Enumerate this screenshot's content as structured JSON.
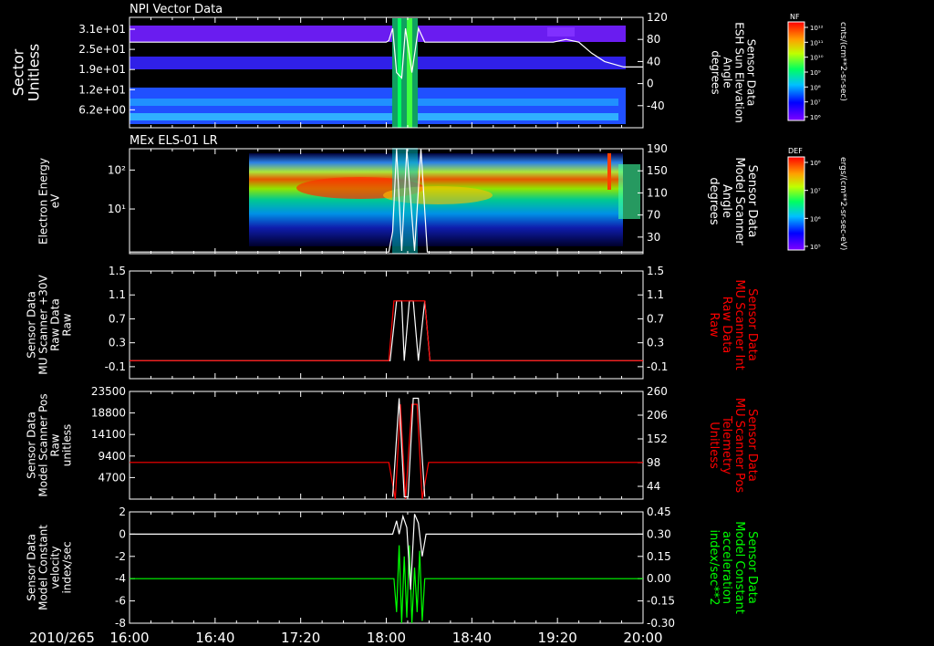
{
  "figure": {
    "date_label": "2010/265",
    "time_ticks": [
      "16:00",
      "16:40",
      "17:20",
      "18:00",
      "18:40",
      "19:20",
      "20:00"
    ],
    "time_range_hours": [
      16.0,
      20.0
    ],
    "background": "#000000",
    "axis_color": "#ffffff"
  },
  "chart_data": [
    {
      "id": "npi",
      "type": "heatmap",
      "title": "NPI Vector Data",
      "ylabel_lines": [
        "Sector",
        "Unitless"
      ],
      "y_ticks": [
        "3.1e+01",
        "2.5e+01",
        "1.9e+01",
        "1.2e+01",
        "6.2e+00"
      ],
      "right_ticks": [
        "120",
        "80",
        "40",
        "0",
        "-40"
      ],
      "right_range": [
        -80,
        120
      ],
      "right_label_lines": [
        "Sensor Data",
        "ESH Sun Elevation",
        "Angle",
        "degrees"
      ],
      "colorbar": {
        "title": "NF",
        "tick_labels": [
          "10¹²",
          "10¹¹",
          "10¹⁰",
          "10⁹",
          "10⁸",
          "10⁷",
          "10⁶"
        ],
        "unit": "cnts/(cm**2-sr-sec)"
      },
      "series": [
        {
          "color": "#ffffff",
          "x": [
            16.0,
            16.5,
            17.0,
            17.5,
            18.0,
            18.02,
            18.05,
            18.08,
            18.12,
            18.15,
            18.2,
            18.25,
            18.3,
            18.6,
            19.0,
            19.3,
            19.4,
            19.5,
            19.6,
            19.7,
            19.85,
            20.0
          ],
          "y": [
            75,
            75,
            75,
            75,
            75,
            78,
            100,
            20,
            10,
            100,
            20,
            100,
            75,
            75,
            75,
            75,
            80,
            75,
            55,
            40,
            30,
            30
          ]
        }
      ]
    },
    {
      "id": "els",
      "type": "heatmap",
      "title": "MEx ELS-01 LR",
      "ylabel_lines": [
        "Electron Energy",
        "eV"
      ],
      "y_ticks": [
        "10²",
        "10¹"
      ],
      "right_ticks": [
        "190",
        "150",
        "110",
        "70",
        "30"
      ],
      "right_range": [
        0,
        190
      ],
      "right_label_lines": [
        "Sensor Data",
        "Model Scanner",
        "Angle",
        "degrees"
      ],
      "colorbar": {
        "title": "DEF",
        "tick_labels": [
          "10⁸",
          "10⁷",
          "10⁶",
          "10⁵"
        ],
        "unit": "ergs/(cm**2-sr-sec-eV)"
      },
      "series": [
        {
          "color": "#ffffff",
          "x": [
            16.0,
            18.02,
            18.05,
            18.08,
            18.12,
            18.16,
            18.22,
            18.27,
            18.32,
            20.0
          ],
          "y": [
            3,
            3,
            40,
            190,
            5,
            190,
            5,
            190,
            3,
            3
          ]
        }
      ]
    },
    {
      "id": "raw",
      "type": "line",
      "title": "",
      "ylabel_lines": [
        "Sensor Data",
        "MU Scanner +30V",
        "Raw Data",
        "Raw"
      ],
      "ylabel_color": "#ffffff",
      "y_ticks": [
        "1.5",
        "1.1",
        "0.7",
        "0.3",
        "-0.1"
      ],
      "y_range": [
        -0.3,
        1.5
      ],
      "right_ticks": [
        "1.5",
        "1.1",
        "0.7",
        "0.3",
        "-0.1"
      ],
      "right_label_lines": [
        "Sensor Data",
        "MU Scanner Int",
        "Raw Data",
        "Raw"
      ],
      "right_label_color": "#ff0000",
      "series": [
        {
          "color": "#ffffff",
          "x": [
            16.0,
            18.03,
            18.08,
            18.12,
            18.14,
            18.18,
            18.21,
            18.25,
            18.3,
            18.34,
            20.0
          ],
          "y": [
            0,
            0,
            1.0,
            1.0,
            0,
            1.0,
            1.0,
            0,
            1.0,
            0,
            0
          ]
        },
        {
          "color": "#ff0000",
          "x": [
            16.0,
            18.02,
            18.06,
            18.3,
            18.34,
            20.0
          ],
          "y": [
            0,
            0,
            1.0,
            1.0,
            0,
            0
          ]
        }
      ]
    },
    {
      "id": "pos",
      "type": "line",
      "title": "",
      "ylabel_lines": [
        "Sensor Data",
        "Model Scanner Pos",
        "Raw",
        "unitless"
      ],
      "ylabel_color": "#ffffff",
      "y_ticks": [
        "23500",
        "18800",
        "14100",
        "9400",
        "4700"
      ],
      "y_range": [
        0,
        23500
      ],
      "right_ticks": [
        "260",
        "206",
        "152",
        "98",
        "44"
      ],
      "right_label_lines": [
        "Sensor Data",
        "MU Scanner Pos",
        "Telemetry",
        "Unitless"
      ],
      "right_label_color": "#ff0000",
      "series": [
        {
          "color": "#ff0000",
          "x": [
            16.0,
            18.02,
            18.07,
            18.11,
            18.15,
            18.2,
            18.24,
            18.28,
            18.33,
            20.0
          ],
          "y": [
            8000,
            8000,
            0,
            20700,
            0,
            20700,
            20700,
            0,
            8000,
            8000
          ]
        },
        {
          "color": "#ffffff",
          "x": [
            18.05,
            18.1,
            18.14,
            18.17,
            18.21,
            18.25,
            18.3
          ],
          "y": [
            500,
            22000,
            500,
            500,
            22000,
            22000,
            500
          ]
        }
      ]
    },
    {
      "id": "vel",
      "type": "line",
      "title": "",
      "ylabel_lines": [
        "Sensor Data",
        "Model Constant",
        "velocity",
        "index/sec"
      ],
      "ylabel_color": "#ffffff",
      "y_ticks": [
        "2",
        "0",
        "-2",
        "-4",
        "-6",
        "-8"
      ],
      "y_range": [
        -8,
        2
      ],
      "right_ticks": [
        "0.45",
        "0.30",
        "0.15",
        "0.00",
        "-0.15",
        "-0.30"
      ],
      "right_label_lines": [
        "Sensor Data",
        "Model Constant",
        "acceleration",
        "index/sec**2"
      ],
      "right_label_color": "#00ff00",
      "series": [
        {
          "color": "#00ff00",
          "x": [
            16.0,
            18.06,
            18.08,
            18.1,
            18.12,
            18.14,
            18.16,
            18.18,
            18.2,
            18.22,
            18.24,
            18.26,
            18.28,
            18.3,
            20.0
          ],
          "y": [
            -4,
            -4,
            -7,
            -1,
            -8,
            -2,
            -7.5,
            -1,
            -8,
            -3,
            -7,
            -1.5,
            -7.8,
            -4,
            -4
          ]
        },
        {
          "color": "#ffffff",
          "x": [
            16.0,
            18.05,
            18.08,
            18.1,
            18.13,
            18.16,
            18.19,
            18.22,
            18.25,
            18.28,
            18.31,
            20.0
          ],
          "y": [
            0,
            0,
            1.2,
            0,
            1.6,
            0.6,
            -5,
            1.8,
            1.0,
            -2,
            0,
            0
          ]
        }
      ]
    }
  ]
}
